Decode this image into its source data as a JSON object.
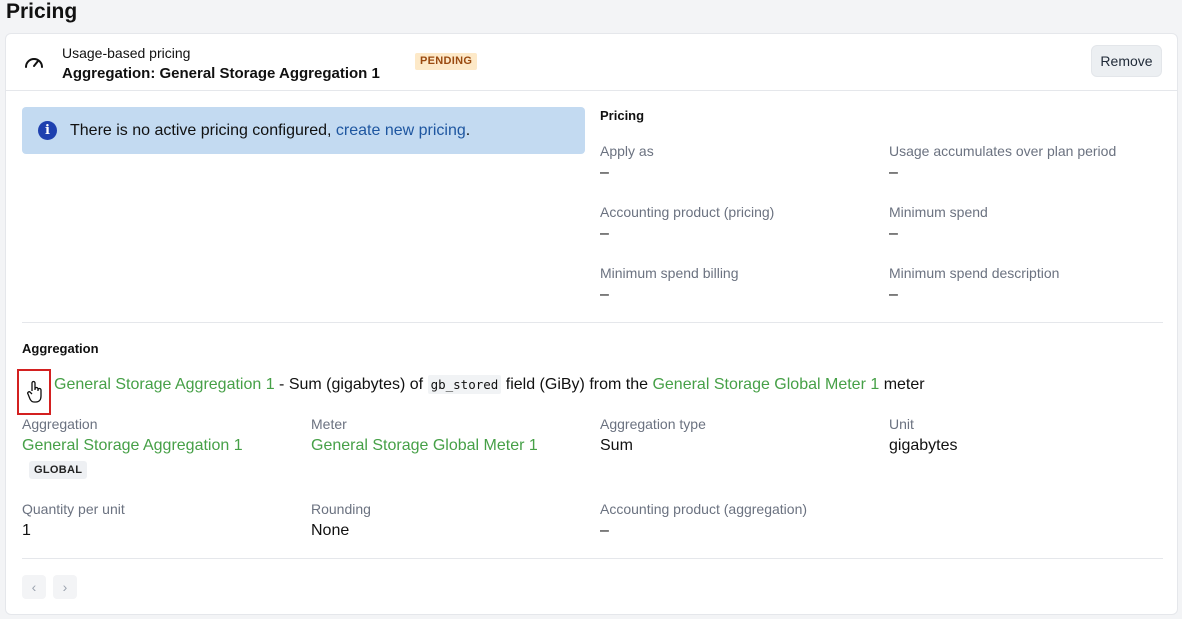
{
  "page": {
    "title": "Pricing"
  },
  "header": {
    "subtitle": "Usage-based pricing",
    "title": "Aggregation: General Storage Aggregation 1",
    "badge": "PENDING",
    "remove_label": "Remove",
    "icon": "gauge-icon"
  },
  "alert": {
    "text": "There is no active pricing configured, ",
    "link": "create new pricing",
    "suffix": ".",
    "icon": "info-icon"
  },
  "pricing": {
    "heading": "Pricing",
    "fields": [
      {
        "label": "Apply as",
        "value": "–"
      },
      {
        "label": "Usage accumulates over plan period",
        "value": "–"
      },
      {
        "label": "Accounting product (pricing)",
        "value": "–"
      },
      {
        "label": "Minimum spend",
        "value": "–"
      },
      {
        "label": "Minimum spend billing",
        "value": "–"
      },
      {
        "label": "Minimum spend description",
        "value": "–"
      }
    ]
  },
  "aggregation": {
    "heading": "Aggregation",
    "sentence": {
      "agg_link": "General Storage Aggregation 1",
      "part1": " - Sum (gigabytes) of ",
      "code": "gb_stored",
      "part2": " field (GiBy) from the ",
      "meter_link": "General Storage Global Meter 1",
      "part3": " meter"
    },
    "fields": [
      {
        "label": "Aggregation",
        "value": "General Storage Aggregation 1",
        "badge": "GLOBAL"
      },
      {
        "label": "Meter",
        "value": "General Storage Global Meter 1"
      },
      {
        "label": "Aggregation type",
        "value": "Sum"
      },
      {
        "label": "Unit",
        "value": "gigabytes"
      },
      {
        "label": "Quantity per unit",
        "value": "1"
      },
      {
        "label": "Rounding",
        "value": "None"
      },
      {
        "label": "Accounting product (aggregation)",
        "value": "–"
      }
    ]
  },
  "pager": {
    "prev_icon": "chevron-left-icon",
    "next_icon": "chevron-right-icon"
  },
  "colors": {
    "link_green": "#46a047",
    "link_blue": "#1e56a0",
    "alert_bg": "#c3daf1",
    "badge_pending_bg": "#fde9c8"
  }
}
